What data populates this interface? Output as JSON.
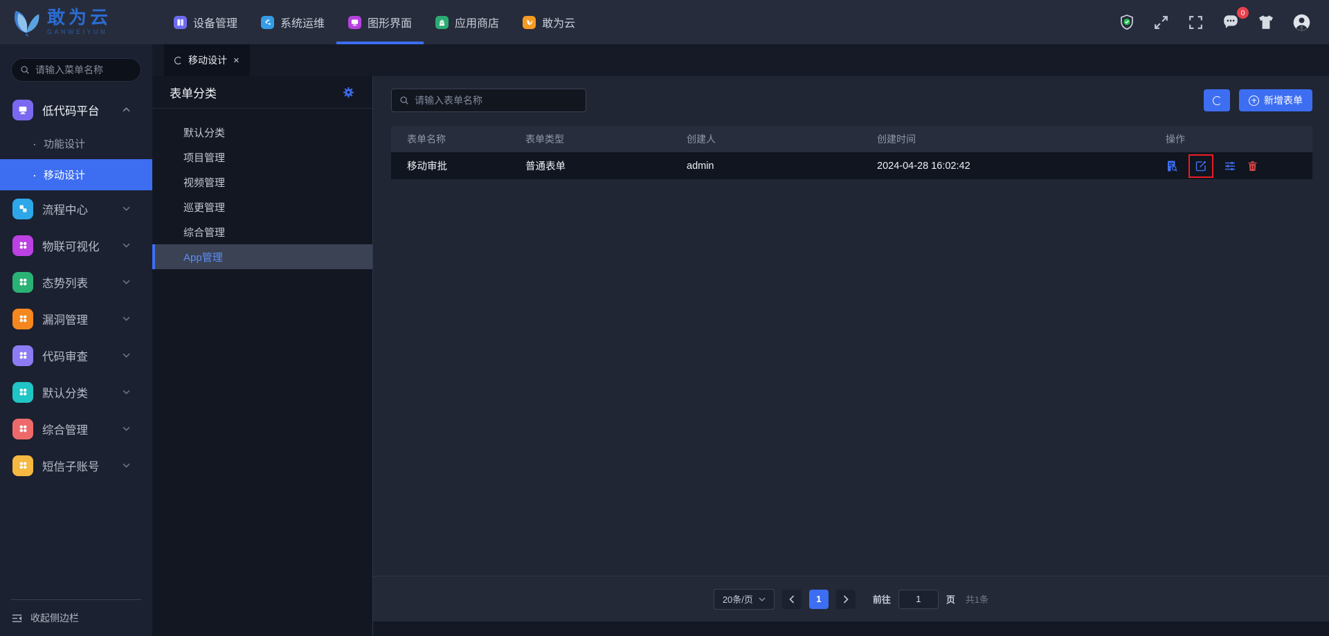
{
  "topbar": {
    "logo": {
      "title": "敢为云",
      "subtitle": "GANWEIYUN"
    },
    "menu": [
      {
        "label": "设备管理",
        "color": "#6e6bf0"
      },
      {
        "label": "系统运维",
        "color": "#369ce8"
      },
      {
        "label": "图形界面",
        "color": "#b542df"
      },
      {
        "label": "应用商店",
        "color": "#2bab72"
      },
      {
        "label": "敢为云",
        "color": "#f59a23"
      }
    ],
    "message_badge": "0"
  },
  "sidebar": {
    "search_placeholder": "请输入菜单名称",
    "groups": [
      {
        "label": "低代码平台",
        "color": "#7b68f0"
      },
      {
        "label": "流程中心",
        "color": "#2ea7e8"
      },
      {
        "label": "物联可视化",
        "color": "#bb41e2"
      },
      {
        "label": "态势列表",
        "color": "#2ab275"
      },
      {
        "label": "漏洞管理",
        "color": "#f5871f"
      },
      {
        "label": "代码审查",
        "color": "#8d7bf3"
      },
      {
        "label": "默认分类",
        "color": "#20c5c5"
      },
      {
        "label": "综合管理",
        "color": "#ee6a6a"
      },
      {
        "label": "短信子账号",
        "color": "#f5b840"
      }
    ],
    "children": [
      {
        "label": "功能设计"
      },
      {
        "label": "移动设计"
      }
    ],
    "collapse_label": "收起侧边栏"
  },
  "tabbar": {
    "active_tab": "移动设计"
  },
  "category_panel": {
    "title": "表单分类",
    "items": [
      {
        "label": "默认分类"
      },
      {
        "label": "项目管理"
      },
      {
        "label": "视频管理"
      },
      {
        "label": "巡更管理"
      },
      {
        "label": "综合管理"
      },
      {
        "label": "App管理"
      }
    ]
  },
  "main": {
    "search_placeholder": "请输入表单名称",
    "add_button_label": "新增表单",
    "table": {
      "columns": [
        "表单名称",
        "表单类型",
        "创建人",
        "创建时间",
        "操作"
      ],
      "rows": [
        {
          "name": "移动审批",
          "type": "普通表单",
          "creator": "admin",
          "created_at": "2024-04-28 16:02:42"
        }
      ]
    },
    "pagination": {
      "page_size_label": "20条/页",
      "current_page": "1",
      "goto_label": "前往",
      "goto_value": "1",
      "page_unit_label": "页",
      "total_label": "共1条"
    }
  },
  "colors": {
    "primary": "#3d6ef2",
    "danger": "#d94b4b",
    "op_blue": "#3d6ef2",
    "annotation_red": "#ec1d24",
    "badge_red": "#e8414d",
    "active_category_text": "#5f8ef5"
  }
}
